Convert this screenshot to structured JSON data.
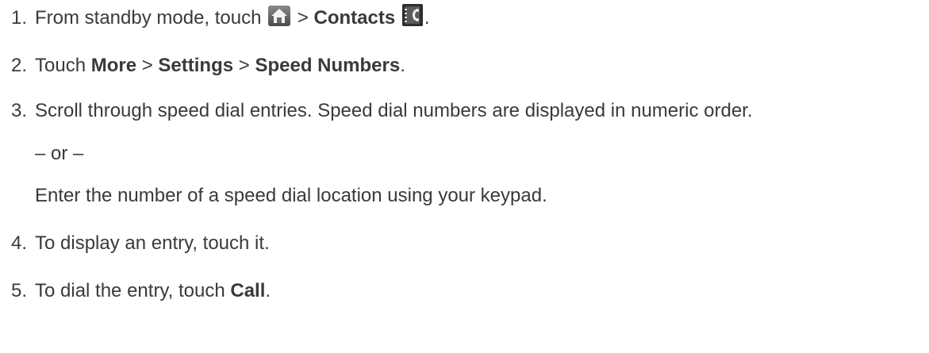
{
  "steps": [
    {
      "num": "1.",
      "text_a": "From standby mode, touch",
      "sep1": ">",
      "bold1": "Contacts",
      "end": ".",
      "icons": [
        "home-icon",
        "contacts-icon"
      ]
    },
    {
      "num": "2.",
      "text_a": "Touch",
      "bold1": "More",
      "sep1": ">",
      "bold2": "Settings",
      "sep2": ">",
      "bold3": "Speed Numbers",
      "end": "."
    },
    {
      "num": "3.",
      "text": "Scroll through speed dial entries. Speed dial numbers are displayed in numeric order.",
      "or": "– or –",
      "alt": "Enter the number of a speed dial location using your keypad."
    },
    {
      "num": "4.",
      "text": "To display an entry, touch it."
    },
    {
      "num": "5.",
      "text_a": "To dial the entry, touch",
      "bold1": "Call",
      "end": "."
    }
  ]
}
